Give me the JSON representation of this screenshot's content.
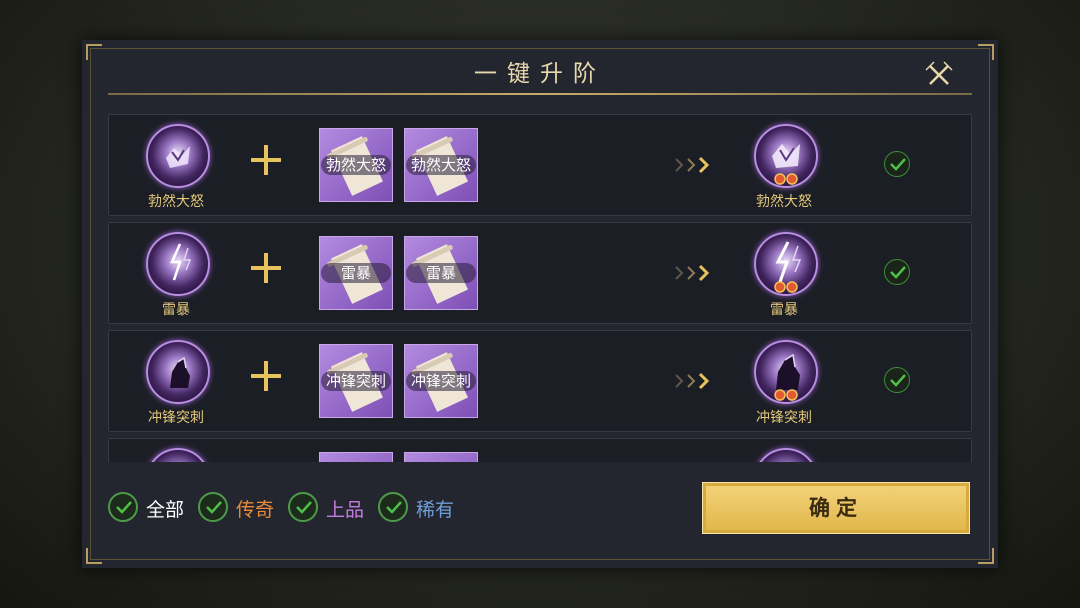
{
  "dialog": {
    "title": "一键升阶",
    "close_icon": "close-x-icon",
    "confirm_label": "确定"
  },
  "rows": [
    {
      "skill": "勃然大怒",
      "material_1": "勃然大怒",
      "material_2": "勃然大怒",
      "result": "勃然大怒",
      "result_stars": 2,
      "selected": true
    },
    {
      "skill": "雷暴",
      "material_1": "雷暴",
      "material_2": "雷暴",
      "result": "雷暴",
      "result_stars": 2,
      "selected": true
    },
    {
      "skill": "冲锋突刺",
      "material_1": "冲锋突刺",
      "material_2": "冲锋突刺",
      "result": "冲锋突刺",
      "result_stars": 2,
      "selected": true
    }
  ],
  "filters": [
    {
      "label": "全部",
      "checked": true,
      "color": "#ffffff"
    },
    {
      "label": "传奇",
      "checked": true,
      "color": "#e8893c"
    },
    {
      "label": "上品",
      "checked": true,
      "color": "#c57ce0"
    },
    {
      "label": "稀有",
      "checked": true,
      "color": "#6f9fd8"
    }
  ],
  "colors": {
    "accent_gold": "#e6c35d",
    "rare_purple": "#9b6ad0",
    "check_green": "#4fbf4a"
  }
}
